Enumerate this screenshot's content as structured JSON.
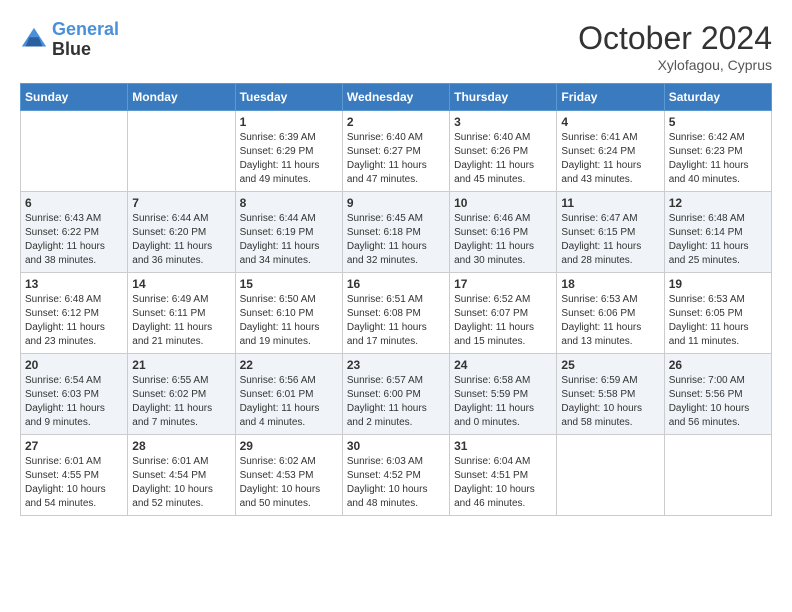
{
  "header": {
    "logo_line1": "General",
    "logo_line2": "Blue",
    "month": "October 2024",
    "location": "Xylofagou, Cyprus"
  },
  "weekdays": [
    "Sunday",
    "Monday",
    "Tuesday",
    "Wednesday",
    "Thursday",
    "Friday",
    "Saturday"
  ],
  "weeks": [
    [
      {
        "day": "",
        "sunrise": "",
        "sunset": "",
        "daylight": ""
      },
      {
        "day": "",
        "sunrise": "",
        "sunset": "",
        "daylight": ""
      },
      {
        "day": "1",
        "sunrise": "Sunrise: 6:39 AM",
        "sunset": "Sunset: 6:29 PM",
        "daylight": "Daylight: 11 hours and 49 minutes."
      },
      {
        "day": "2",
        "sunrise": "Sunrise: 6:40 AM",
        "sunset": "Sunset: 6:27 PM",
        "daylight": "Daylight: 11 hours and 47 minutes."
      },
      {
        "day": "3",
        "sunrise": "Sunrise: 6:40 AM",
        "sunset": "Sunset: 6:26 PM",
        "daylight": "Daylight: 11 hours and 45 minutes."
      },
      {
        "day": "4",
        "sunrise": "Sunrise: 6:41 AM",
        "sunset": "Sunset: 6:24 PM",
        "daylight": "Daylight: 11 hours and 43 minutes."
      },
      {
        "day": "5",
        "sunrise": "Sunrise: 6:42 AM",
        "sunset": "Sunset: 6:23 PM",
        "daylight": "Daylight: 11 hours and 40 minutes."
      }
    ],
    [
      {
        "day": "6",
        "sunrise": "Sunrise: 6:43 AM",
        "sunset": "Sunset: 6:22 PM",
        "daylight": "Daylight: 11 hours and 38 minutes."
      },
      {
        "day": "7",
        "sunrise": "Sunrise: 6:44 AM",
        "sunset": "Sunset: 6:20 PM",
        "daylight": "Daylight: 11 hours and 36 minutes."
      },
      {
        "day": "8",
        "sunrise": "Sunrise: 6:44 AM",
        "sunset": "Sunset: 6:19 PM",
        "daylight": "Daylight: 11 hours and 34 minutes."
      },
      {
        "day": "9",
        "sunrise": "Sunrise: 6:45 AM",
        "sunset": "Sunset: 6:18 PM",
        "daylight": "Daylight: 11 hours and 32 minutes."
      },
      {
        "day": "10",
        "sunrise": "Sunrise: 6:46 AM",
        "sunset": "Sunset: 6:16 PM",
        "daylight": "Daylight: 11 hours and 30 minutes."
      },
      {
        "day": "11",
        "sunrise": "Sunrise: 6:47 AM",
        "sunset": "Sunset: 6:15 PM",
        "daylight": "Daylight: 11 hours and 28 minutes."
      },
      {
        "day": "12",
        "sunrise": "Sunrise: 6:48 AM",
        "sunset": "Sunset: 6:14 PM",
        "daylight": "Daylight: 11 hours and 25 minutes."
      }
    ],
    [
      {
        "day": "13",
        "sunrise": "Sunrise: 6:48 AM",
        "sunset": "Sunset: 6:12 PM",
        "daylight": "Daylight: 11 hours and 23 minutes."
      },
      {
        "day": "14",
        "sunrise": "Sunrise: 6:49 AM",
        "sunset": "Sunset: 6:11 PM",
        "daylight": "Daylight: 11 hours and 21 minutes."
      },
      {
        "day": "15",
        "sunrise": "Sunrise: 6:50 AM",
        "sunset": "Sunset: 6:10 PM",
        "daylight": "Daylight: 11 hours and 19 minutes."
      },
      {
        "day": "16",
        "sunrise": "Sunrise: 6:51 AM",
        "sunset": "Sunset: 6:08 PM",
        "daylight": "Daylight: 11 hours and 17 minutes."
      },
      {
        "day": "17",
        "sunrise": "Sunrise: 6:52 AM",
        "sunset": "Sunset: 6:07 PM",
        "daylight": "Daylight: 11 hours and 15 minutes."
      },
      {
        "day": "18",
        "sunrise": "Sunrise: 6:53 AM",
        "sunset": "Sunset: 6:06 PM",
        "daylight": "Daylight: 11 hours and 13 minutes."
      },
      {
        "day": "19",
        "sunrise": "Sunrise: 6:53 AM",
        "sunset": "Sunset: 6:05 PM",
        "daylight": "Daylight: 11 hours and 11 minutes."
      }
    ],
    [
      {
        "day": "20",
        "sunrise": "Sunrise: 6:54 AM",
        "sunset": "Sunset: 6:03 PM",
        "daylight": "Daylight: 11 hours and 9 minutes."
      },
      {
        "day": "21",
        "sunrise": "Sunrise: 6:55 AM",
        "sunset": "Sunset: 6:02 PM",
        "daylight": "Daylight: 11 hours and 7 minutes."
      },
      {
        "day": "22",
        "sunrise": "Sunrise: 6:56 AM",
        "sunset": "Sunset: 6:01 PM",
        "daylight": "Daylight: 11 hours and 4 minutes."
      },
      {
        "day": "23",
        "sunrise": "Sunrise: 6:57 AM",
        "sunset": "Sunset: 6:00 PM",
        "daylight": "Daylight: 11 hours and 2 minutes."
      },
      {
        "day": "24",
        "sunrise": "Sunrise: 6:58 AM",
        "sunset": "Sunset: 5:59 PM",
        "daylight": "Daylight: 11 hours and 0 minutes."
      },
      {
        "day": "25",
        "sunrise": "Sunrise: 6:59 AM",
        "sunset": "Sunset: 5:58 PM",
        "daylight": "Daylight: 10 hours and 58 minutes."
      },
      {
        "day": "26",
        "sunrise": "Sunrise: 7:00 AM",
        "sunset": "Sunset: 5:56 PM",
        "daylight": "Daylight: 10 hours and 56 minutes."
      }
    ],
    [
      {
        "day": "27",
        "sunrise": "Sunrise: 6:01 AM",
        "sunset": "Sunset: 4:55 PM",
        "daylight": "Daylight: 10 hours and 54 minutes."
      },
      {
        "day": "28",
        "sunrise": "Sunrise: 6:01 AM",
        "sunset": "Sunset: 4:54 PM",
        "daylight": "Daylight: 10 hours and 52 minutes."
      },
      {
        "day": "29",
        "sunrise": "Sunrise: 6:02 AM",
        "sunset": "Sunset: 4:53 PM",
        "daylight": "Daylight: 10 hours and 50 minutes."
      },
      {
        "day": "30",
        "sunrise": "Sunrise: 6:03 AM",
        "sunset": "Sunset: 4:52 PM",
        "daylight": "Daylight: 10 hours and 48 minutes."
      },
      {
        "day": "31",
        "sunrise": "Sunrise: 6:04 AM",
        "sunset": "Sunset: 4:51 PM",
        "daylight": "Daylight: 10 hours and 46 minutes."
      },
      {
        "day": "",
        "sunrise": "",
        "sunset": "",
        "daylight": ""
      },
      {
        "day": "",
        "sunrise": "",
        "sunset": "",
        "daylight": ""
      }
    ]
  ]
}
